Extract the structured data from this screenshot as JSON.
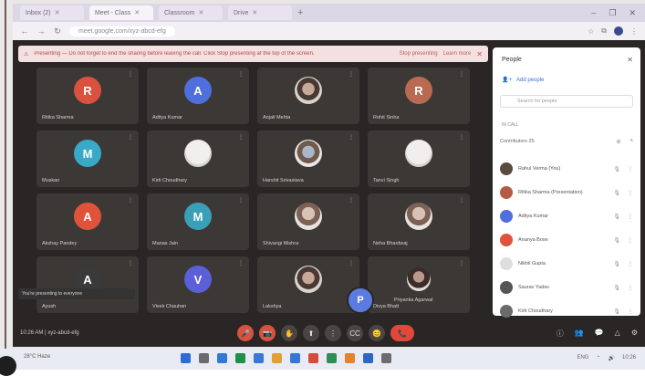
{
  "browser": {
    "tabs": [
      {
        "label": "Inbox (2)",
        "active": false
      },
      {
        "label": "Meet - Class",
        "active": true
      },
      {
        "label": "Classroom",
        "active": false
      },
      {
        "label": "Drive",
        "active": false
      }
    ],
    "url": "meet.google.com/xyz-abcd-efg",
    "window_controls": [
      "–",
      "❐",
      "✕"
    ]
  },
  "banner": {
    "message": "Presenting — Do not forget to end the sharing before leaving the call. Click Stop presenting at the top of the screen.",
    "link1": "Stop presenting",
    "link2": "Learn more"
  },
  "tiles": [
    {
      "name": "Ritika Sharma",
      "avatar": "letter",
      "letter": "R",
      "color": "#d9513f"
    },
    {
      "name": "Aditya Kumar",
      "avatar": "letter",
      "letter": "A",
      "color": "#4f6fdc"
    },
    {
      "name": "Anjali Mehta",
      "avatar": "photo4"
    },
    {
      "name": "Rohit Sinha",
      "avatar": "letter",
      "letter": "R",
      "color": "#b86a52"
    },
    {
      "name": "Muskan",
      "avatar": "letter",
      "letter": "M",
      "color": "#3aa9c8"
    },
    {
      "name": "Kirti Choudhary",
      "avatar": "photo3"
    },
    {
      "name": "Harshit Srivastava",
      "avatar": "photo2"
    },
    {
      "name": "Tanvi Singh",
      "avatar": "photo3"
    },
    {
      "name": "Akshay Pandey",
      "avatar": "letter",
      "letter": "A",
      "color": "#e0533b"
    },
    {
      "name": "Manas Jain",
      "avatar": "letter",
      "letter": "M",
      "color": "#3aa0b8"
    },
    {
      "name": "Shivangi Mishra",
      "avatar": "photo5"
    },
    {
      "name": "Neha Bhardwaj",
      "avatar": "photo5"
    },
    {
      "name": "Ayush",
      "avatar": "letter",
      "letter": "A",
      "color": "#3a3a3a"
    },
    {
      "name": "Vivek Chauhan",
      "avatar": "letter",
      "letter": "V",
      "color": "#5b5fd8"
    },
    {
      "name": "Lakshya",
      "avatar": "photo4"
    },
    {
      "name": "Divya Bhatt",
      "avatar": "small"
    }
  ],
  "toast": "You're presenting to everyone",
  "floating_user": {
    "letter": "P",
    "name": "Priyanka Agarwal"
  },
  "meeting_info": "10:26 AM  |  xyz-abcd-efg",
  "controls": [
    "🎤",
    "📷",
    "✋",
    "⬆",
    "⋮",
    "CC",
    "😊",
    "📞"
  ],
  "right_controls": [
    "ⓘ",
    "👥",
    "💬",
    "△",
    "⚙"
  ],
  "panel": {
    "title": "People",
    "add_people": "Add people",
    "search_placeholder": "Search for people",
    "section_label": "IN CALL",
    "contributors_label": "Contributors",
    "contributors_count": "25",
    "people": [
      {
        "name": "Rahul Verma (You)",
        "color": "#5b4a40"
      },
      {
        "name": "Ritika Sharma (Presentation)",
        "color": "#b45b45"
      },
      {
        "name": "Aditya Kumar",
        "color": "#4f6fdc"
      },
      {
        "name": "Ananya Bose",
        "color": "#e0533b"
      },
      {
        "name": "Nikhil Gupta",
        "color": "#dedede"
      },
      {
        "name": "Saurav Yadav",
        "color": "#555555"
      },
      {
        "name": "Kirti Choudhary",
        "color": "#6b6b6b"
      }
    ]
  },
  "taskbar": {
    "weather": "28°C Haze",
    "icon_colors": [
      "#2c6bd8",
      "#6b6b6b",
      "#2f7ad6",
      "#1f8f4a",
      "#3a78d8",
      "#e1a030",
      "#3776d6",
      "#d94a3a",
      "#2d8f55",
      "#e4832c",
      "#2b67c4",
      "#6c6c6c"
    ],
    "tray": [
      "ENG",
      "⌃",
      "🔊",
      "10:26"
    ]
  }
}
